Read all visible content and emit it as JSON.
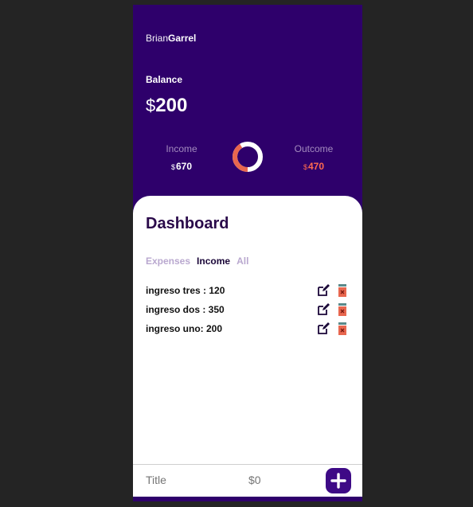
{
  "user": {
    "first_name": "Brian",
    "last_name": "Garrel"
  },
  "balance": {
    "label": "Balance",
    "currency": "$",
    "amount": "200"
  },
  "income": {
    "label": "Income",
    "currency": "$",
    "amount": "670"
  },
  "outcome": {
    "label": "Outcome",
    "currency": "$",
    "amount": "470"
  },
  "dashboard": {
    "title": "Dashboard",
    "tabs": [
      {
        "label": "Expenses"
      },
      {
        "label": "Income"
      },
      {
        "label": "All"
      }
    ],
    "active_tab": "Income",
    "items": [
      {
        "text": "ingreso tres : 120"
      },
      {
        "text": "ingreso dos : 350"
      },
      {
        "text": "ingreso uno: 200"
      }
    ]
  },
  "form": {
    "title_placeholder": "Title",
    "amount_placeholder": "$0"
  },
  "colors": {
    "header_bg": "#2e006b",
    "accent_outcome": "#ff6a4f",
    "edit_icon": "#1a0638",
    "delete_icon": "#e8674f",
    "delete_icon_lid": "#5a8a8a",
    "add_button": "#3e0a86"
  },
  "icons": {
    "edit": "edit-icon",
    "delete": "trash-icon",
    "add": "plus-icon"
  },
  "donut": {
    "income_fraction": 0.5877,
    "outcome_fraction": 0.4123
  }
}
